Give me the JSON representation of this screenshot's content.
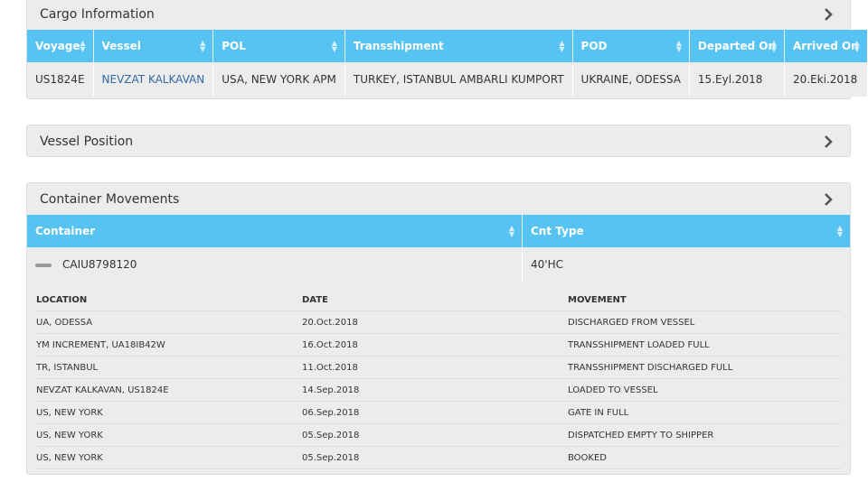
{
  "cargo": {
    "title": "Cargo Information",
    "columns": [
      "Voyage",
      "Vessel",
      "POL",
      "Transshipment",
      "POD",
      "Departed On",
      "Arrived On"
    ],
    "row": [
      "US1824E",
      "NEVZAT KALKAVAN",
      "USA, NEW YORK APM",
      "TURKEY, ISTANBUL AMBARLI KUMPORT",
      "UKRAINE, ODESSA",
      "15.Eyl.2018",
      "20.Eki.2018"
    ]
  },
  "vessel_position": {
    "title": "Vessel Position"
  },
  "container_movements": {
    "title": "Container Movements",
    "columns": [
      "Container",
      "Cnt Type"
    ],
    "container": {
      "id": "CAIU8798120",
      "type": "40'HC"
    },
    "movement_headers": [
      "LOCATION",
      "DATE",
      "MOVEMENT"
    ],
    "movements": [
      [
        "UA, ODESSA",
        "20.Oct.2018",
        "DISCHARGED FROM VESSEL"
      ],
      [
        "YM INCREMENT, UA18IB42W",
        "16.Oct.2018",
        "TRANSSHIPMENT LOADED FULL"
      ],
      [
        "TR, ISTANBUL",
        "11.Oct.2018",
        "TRANSSHIPMENT DISCHARGED FULL"
      ],
      [
        "NEVZAT KALKAVAN, US1824E",
        "14.Sep.2018",
        "LOADED TO VESSEL"
      ],
      [
        "US, NEW YORK",
        "06.Sep.2018",
        "GATE IN FULL"
      ],
      [
        "US, NEW YORK",
        "05.Sep.2018",
        "DISPATCHED EMPTY TO SHIPPER"
      ],
      [
        "US, NEW YORK",
        "05.Sep.2018",
        "BOOKED"
      ]
    ]
  },
  "colors": {
    "header_blue": "#56c3f2",
    "panel_bg": "#ececec",
    "link": "#2f6aa5"
  },
  "icons": {
    "panel_toggle": "chevron-right-icon",
    "sort": "sort-icon",
    "collapse": "minus-icon"
  }
}
